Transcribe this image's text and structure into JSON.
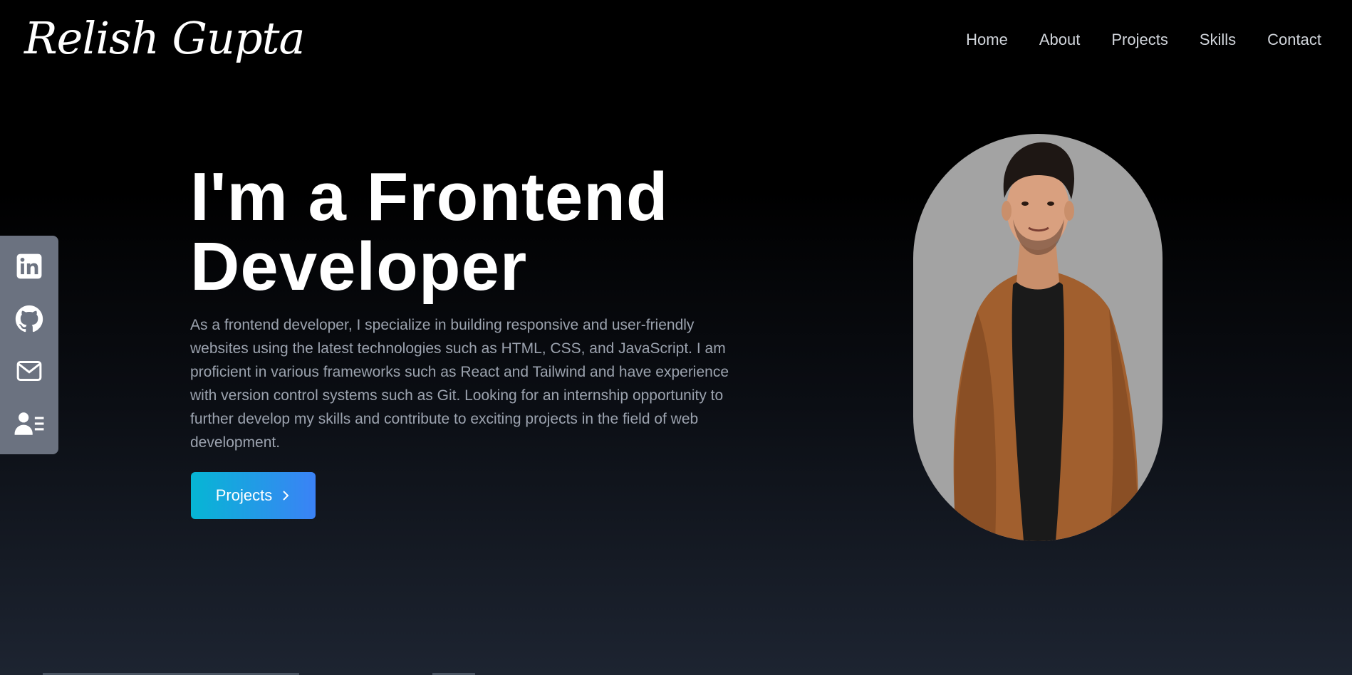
{
  "header": {
    "logo_text": "Relish Gupta",
    "nav": [
      {
        "label": "Home"
      },
      {
        "label": "About"
      },
      {
        "label": "Projects"
      },
      {
        "label": "Skills"
      },
      {
        "label": "Contact"
      }
    ]
  },
  "social_bar": {
    "icons": [
      "linkedin-icon",
      "github-icon",
      "mail-icon",
      "resume-icon"
    ]
  },
  "hero": {
    "title_line1": "I'm a Frontend",
    "title_line2": "Developer",
    "description": "As a frontend developer, I specialize in building responsive and user-friendly websites using the latest technologies such as HTML, CSS, and JavaScript. I am proficient in various frameworks such as React and Tailwind and have experience with version control systems such as Git. Looking for an internship opportunity to further develop my skills and contribute to exciting projects in the field of web development.",
    "cta_label": "Projects",
    "cta_icon": "chevron-right-icon"
  },
  "colors": {
    "accent_start": "#06b6d4",
    "accent_end": "#3b82f6",
    "sidebar_bg": "#6b7280",
    "portrait_bg": "#a3a3a3",
    "jacket": "#a15f2e"
  }
}
